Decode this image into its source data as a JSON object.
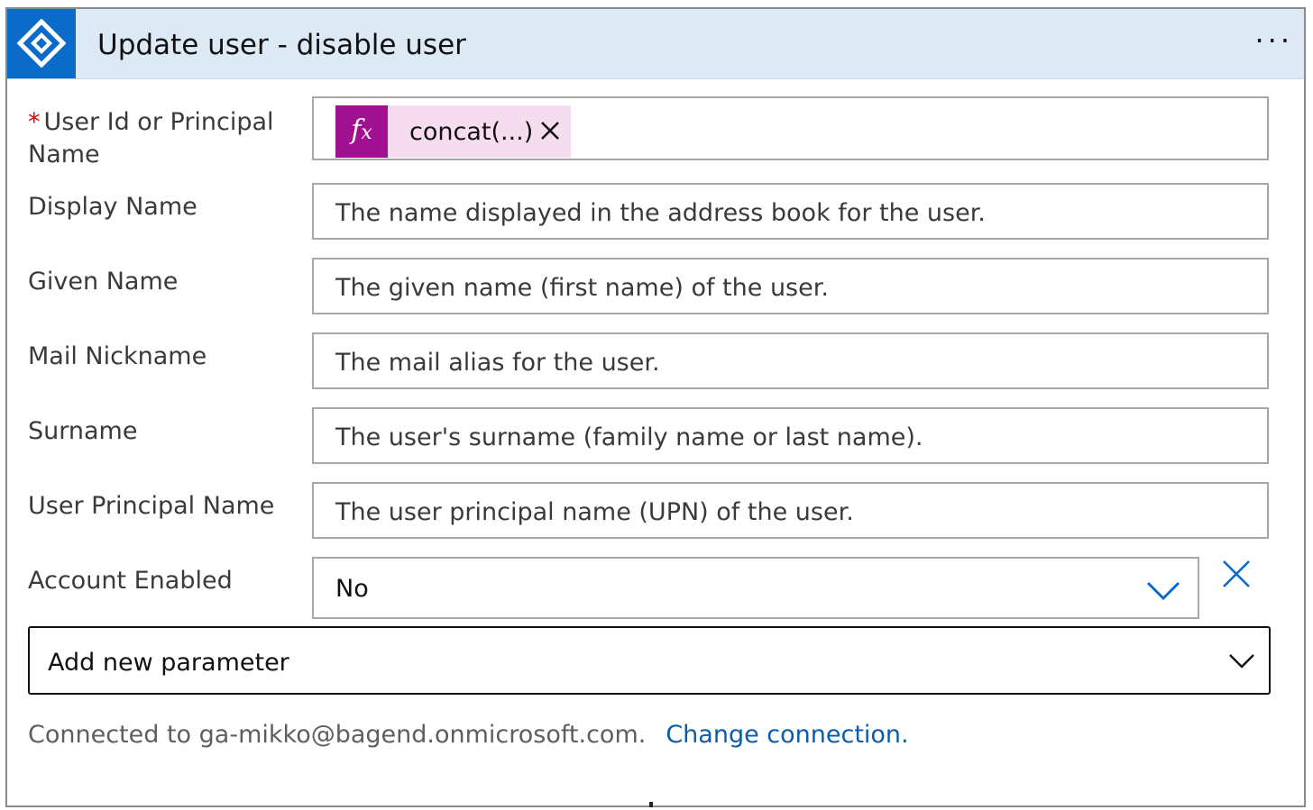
{
  "header": {
    "title": "Update user - disable user",
    "icon": "azure-active-directory-icon",
    "more_label": "···",
    "accent_color": "#0a6bc9",
    "header_bg": "#dde9f5"
  },
  "fields": [
    {
      "label": "User Id or Principal Name",
      "label_line1": "User Id or Principal",
      "label_line2": "Name",
      "required": true,
      "token": {
        "icon": "fx",
        "text": "concat(...)",
        "remove_icon": "close-icon",
        "color": "#a21092"
      }
    },
    {
      "label": "Display Name",
      "placeholder": "The name displayed in the address book for the user."
    },
    {
      "label": "Given Name",
      "placeholder": "The given name (first name) of the user."
    },
    {
      "label": "Mail Nickname",
      "placeholder": "The mail alias for the user."
    },
    {
      "label": "Surname",
      "placeholder": "The user's surname (family name or last name)."
    },
    {
      "label": "User Principal Name",
      "placeholder": "The user principal name (UPN) of the user."
    },
    {
      "label": "Account Enabled",
      "value": "No",
      "dropdown_icon": "chevron-down-icon",
      "clear_icon": "close-icon"
    }
  ],
  "add_parameter": {
    "label": "Add new parameter",
    "icon": "chevron-down-icon"
  },
  "footer": {
    "connected_text": "Connected to ga-mikko@bagend.onmicrosoft.com.",
    "change_link": "Change connection.",
    "link_color": "#0b5cad"
  }
}
